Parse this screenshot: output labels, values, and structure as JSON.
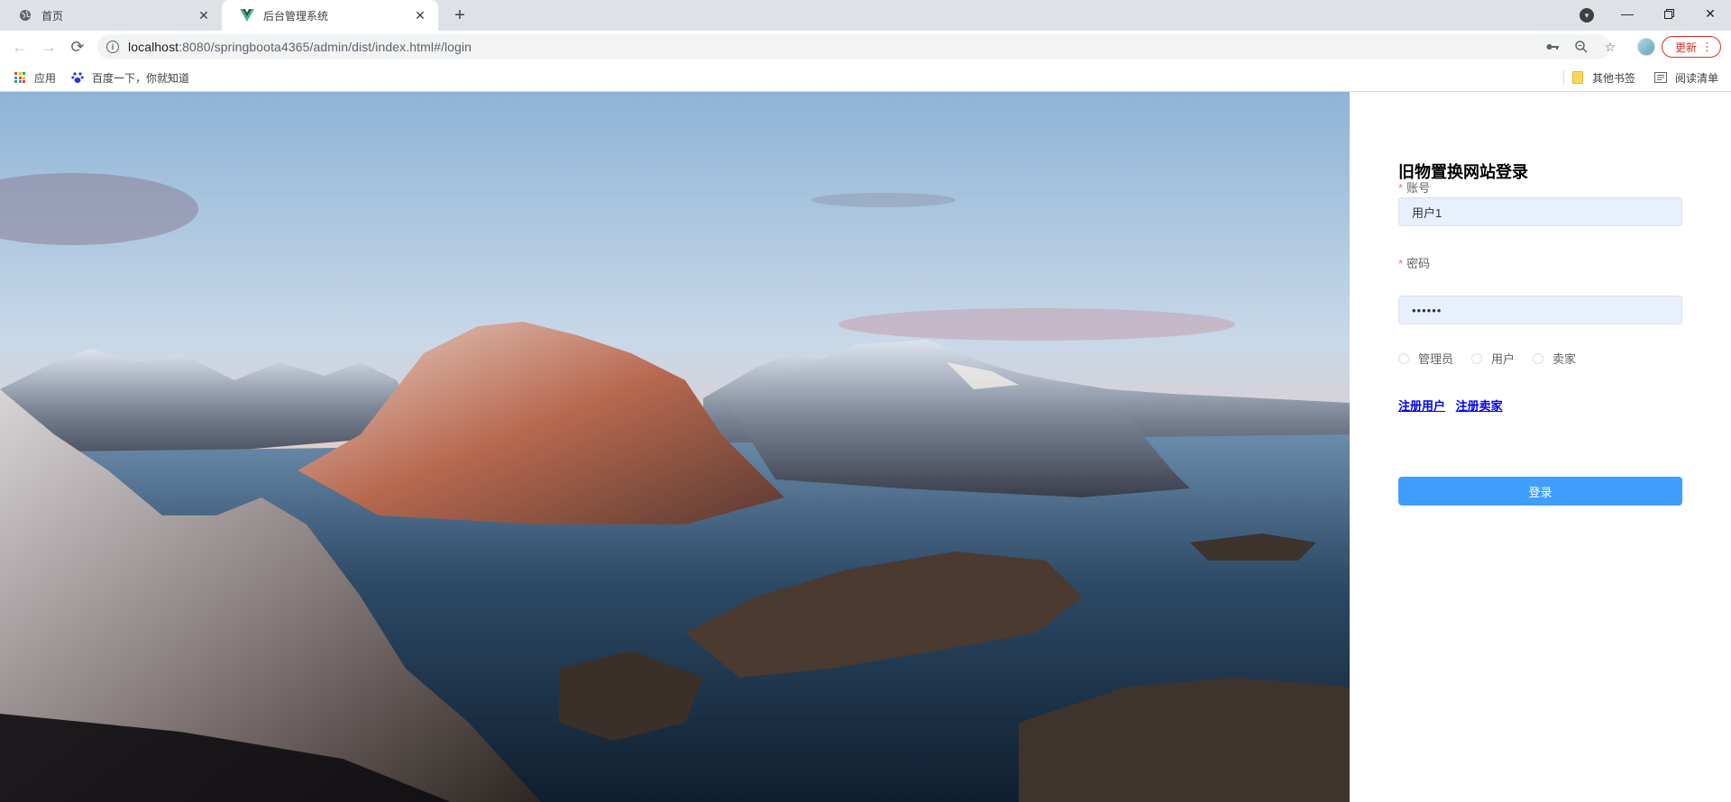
{
  "browser": {
    "tabs": [
      {
        "title": "首页",
        "icon": "globe-icon"
      },
      {
        "title": "后台管理系统",
        "icon": "vue-logo-icon"
      }
    ],
    "url_host": "localhost",
    "url_rest": ":8080/springboota4365/admin/dist/index.html#/login",
    "update_label": "更新",
    "bookmarks": {
      "apps": "应用",
      "baidu": "百度一下，你就知道",
      "other": "其他书签",
      "reading_list": "阅读清单"
    }
  },
  "login": {
    "title": "旧物置换网站登录",
    "account_label": "账号",
    "account_value": "用户1",
    "password_label": "密码",
    "password_value": "••••••",
    "roles": [
      "管理员",
      "用户",
      "卖家"
    ],
    "register_user": "注册用户",
    "register_seller": "注册卖家",
    "submit": "登录"
  },
  "colors": {
    "primary": "#409eff",
    "input_bg": "#e8f0fe",
    "required": "#f56c6c",
    "link": "#0000ee"
  }
}
